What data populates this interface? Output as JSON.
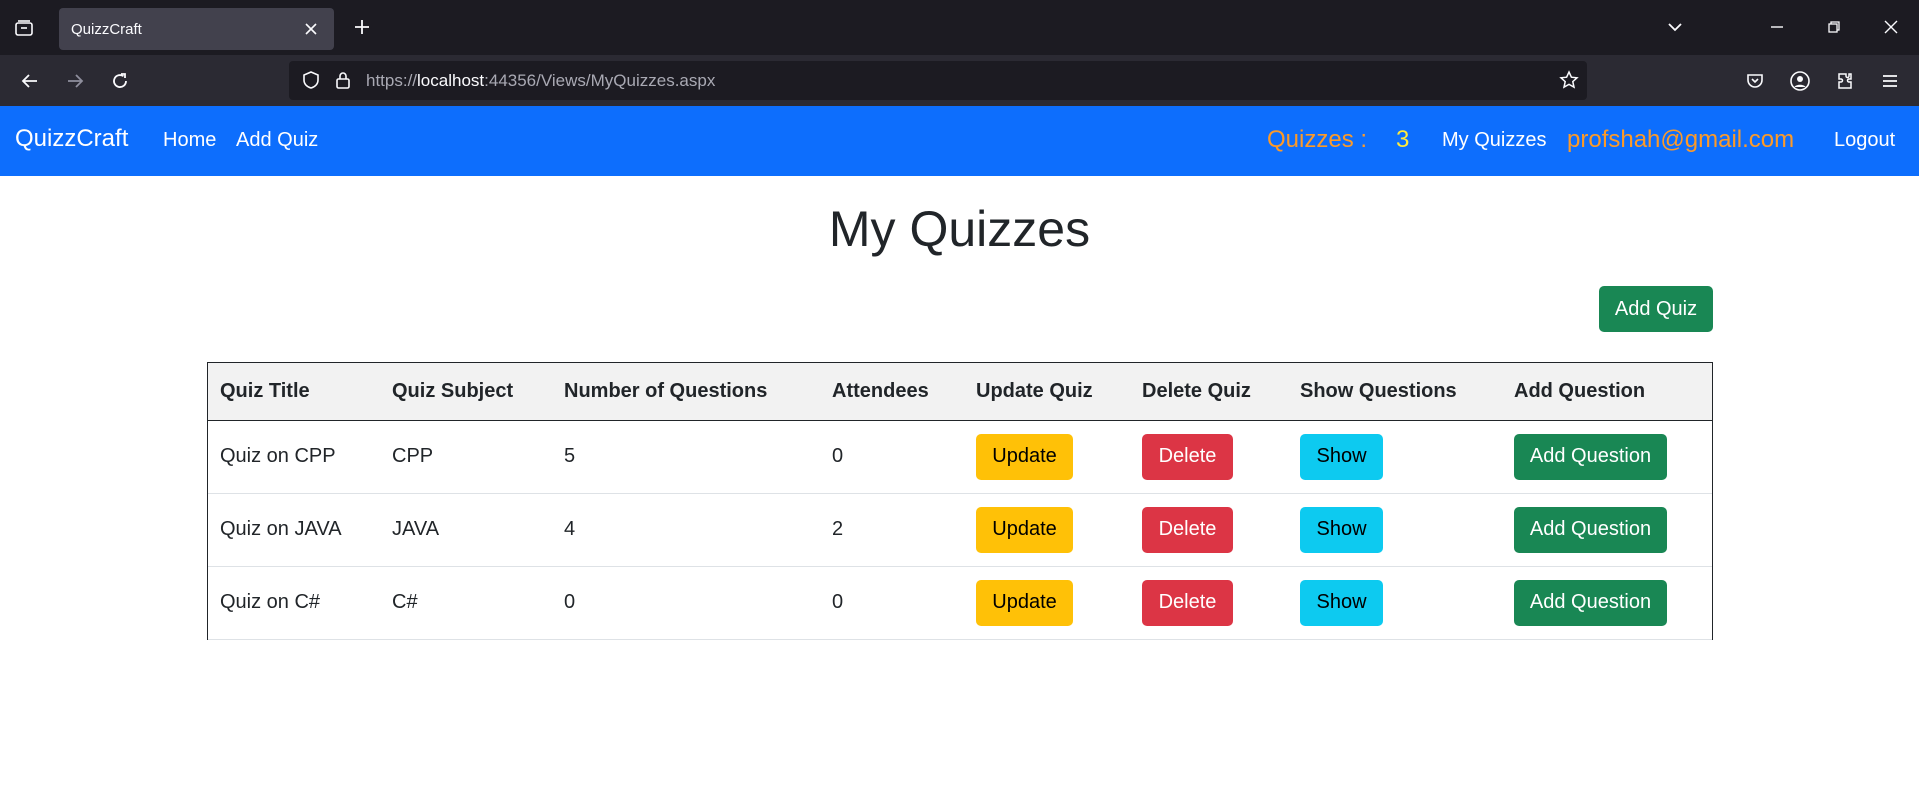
{
  "browser": {
    "tab_title": "QuizzCraft",
    "url_prefix": "https://",
    "url_host": "localhost",
    "url_rest": ":44356/Views/MyQuizzes.aspx"
  },
  "nav": {
    "brand": "QuizzCraft",
    "home": "Home",
    "add_quiz": "Add Quiz",
    "quizzes_label": "Quizzes :",
    "quizzes_count": "3",
    "my_quizzes": "My Quizzes",
    "email": "profshah@gmail.com",
    "logout": "Logout"
  },
  "main": {
    "title": "My Quizzes",
    "add_quiz_button": "Add Quiz"
  },
  "table": {
    "headers": [
      "Quiz Title",
      "Quiz Subject",
      "Number of Questions",
      "Attendees",
      "Update Quiz",
      "Delete Quiz",
      "Show Questions",
      "Add Question"
    ],
    "rows": [
      {
        "title": "Quiz on CPP",
        "subject": "CPP",
        "questions": "5",
        "attendees": "0"
      },
      {
        "title": "Quiz on JAVA",
        "subject": "JAVA",
        "questions": "4",
        "attendees": "2"
      },
      {
        "title": "Quiz on C#",
        "subject": "C#",
        "questions": "0",
        "attendees": "0"
      }
    ],
    "update_label": "Update",
    "delete_label": "Delete",
    "show_label": "Show",
    "add_question_label": "Add Question"
  },
  "colors": {
    "navbar": "#0d6efd",
    "accent_orange": "#fd9a28",
    "count_yellow": "#ffeb3b",
    "success": "#198754",
    "warning": "#ffc107",
    "danger": "#dc3545",
    "info": "#0dcaf0"
  }
}
